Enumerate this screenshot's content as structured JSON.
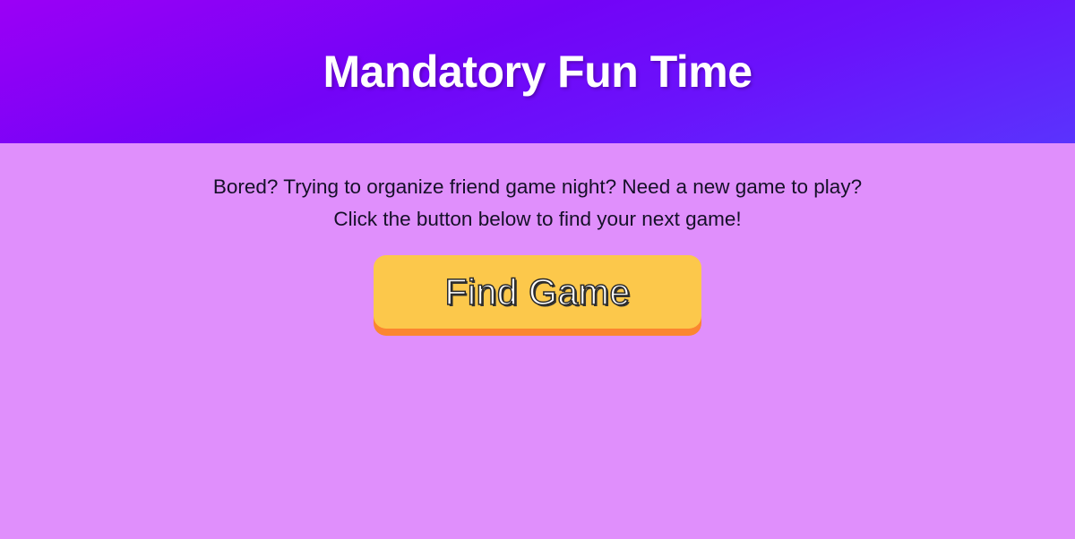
{
  "header": {
    "title": "Mandatory Fun Time"
  },
  "main": {
    "intro_line1": "Bored? Trying to organize friend game night? Need a new game to play?",
    "intro_line2": "Click the button below to find your next game!",
    "find_button_label": "Find Game"
  },
  "colors": {
    "header_gradient_start": "#9b00f6",
    "header_gradient_end": "#5a33fd",
    "page_background": "#e08ffc",
    "button_face": "#fcc84b",
    "button_edge": "#fb8630"
  }
}
